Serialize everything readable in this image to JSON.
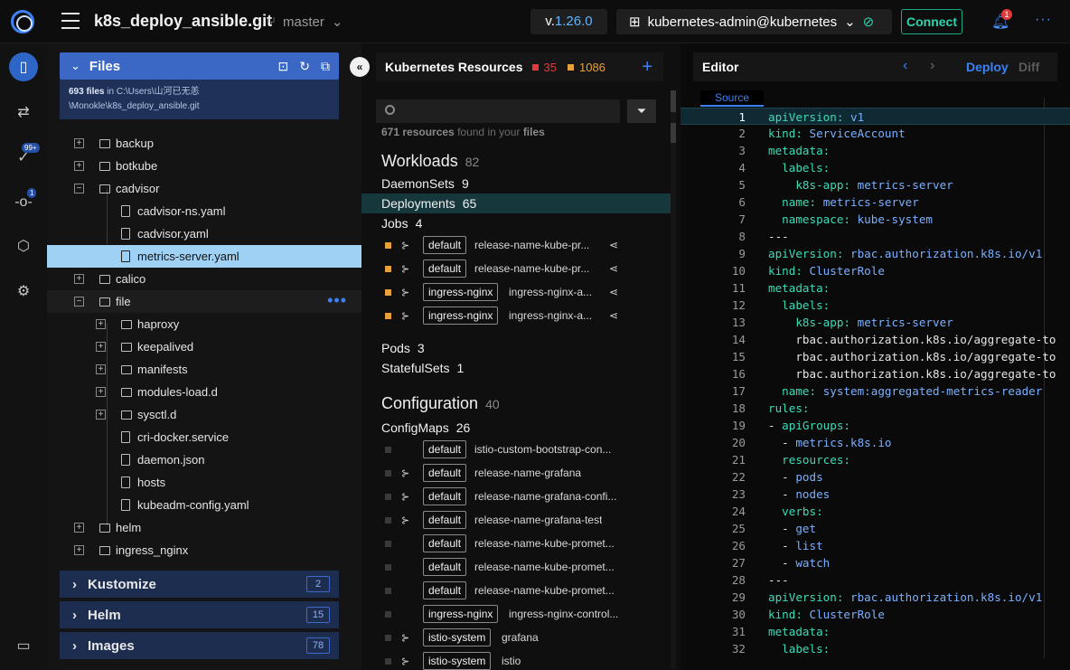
{
  "topbar": {
    "repo": "k8s_deploy_ansible.git",
    "branch": "master",
    "version_prefix": "v.",
    "version_num": "1.26.0",
    "cluster": "kubernetes-admin@kubernetes",
    "connect": "Connect",
    "notifications": "1",
    "more": "···"
  },
  "rail": {
    "badge_validation": "99+",
    "badge_git": "1"
  },
  "files": {
    "title": "Files",
    "count": "693 files",
    "in": "in",
    "path1": "C:\\Users\\山河已无恙",
    "path2": "\\Monokle\\k8s_deploy_ansible.git",
    "tree": [
      {
        "label": "backup"
      },
      {
        "label": "botkube"
      },
      {
        "label": "cadvisor"
      },
      {
        "label": "cadvisor-ns.yaml"
      },
      {
        "label": "cadvisor.yaml"
      },
      {
        "label": "metrics-server.yaml"
      },
      {
        "label": "calico"
      },
      {
        "label": "file"
      },
      {
        "label": "haproxy"
      },
      {
        "label": "keepalived"
      },
      {
        "label": "manifests"
      },
      {
        "label": "modules-load.d"
      },
      {
        "label": "sysctl.d"
      },
      {
        "label": "cri-docker.service"
      },
      {
        "label": "daemon.json"
      },
      {
        "label": "hosts"
      },
      {
        "label": "kubeadm-config.yaml"
      },
      {
        "label": "helm"
      },
      {
        "label": "ingress_nginx"
      }
    ],
    "sections": [
      {
        "label": "Kustomize",
        "count": "2"
      },
      {
        "label": "Helm",
        "count": "15"
      },
      {
        "label": "Images",
        "count": "78"
      }
    ]
  },
  "resources": {
    "title": "Kubernetes Resources",
    "errors": "35",
    "warnings": "1086",
    "search_placeholder": "",
    "found_count": "671 resources",
    "found_mid": "found in your",
    "found_end": "files",
    "workloads": {
      "label": "Workloads",
      "count": "82"
    },
    "daemonsets": {
      "label": "DaemonSets",
      "count": "9"
    },
    "deployments": {
      "label": "Deployments",
      "count": "65"
    },
    "jobs": {
      "label": "Jobs",
      "count": "4"
    },
    "job_rows": [
      {
        "ns": "default",
        "name": "release-name-kube-pr..."
      },
      {
        "ns": "default",
        "name": "release-name-kube-pr..."
      },
      {
        "ns": "ingress-nginx",
        "name": "ingress-nginx-a..."
      },
      {
        "ns": "ingress-nginx",
        "name": "ingress-nginx-a..."
      }
    ],
    "pods": {
      "label": "Pods",
      "count": "3"
    },
    "statefulsets": {
      "label": "StatefulSets",
      "count": "1"
    },
    "configuration": {
      "label": "Configuration",
      "count": "40"
    },
    "configmaps": {
      "label": "ConfigMaps",
      "count": "26"
    },
    "cm_rows": [
      {
        "ns": "default",
        "name": "istio-custom-bootstrap-con..."
      },
      {
        "ns": "default",
        "name": "release-name-grafana"
      },
      {
        "ns": "default",
        "name": "release-name-grafana-confi..."
      },
      {
        "ns": "default",
        "name": "release-name-grafana-test"
      },
      {
        "ns": "default",
        "name": "release-name-kube-promet..."
      },
      {
        "ns": "default",
        "name": "release-name-kube-promet..."
      },
      {
        "ns": "default",
        "name": "release-name-kube-promet..."
      },
      {
        "ns": "ingress-nginx",
        "name": "ingress-nginx-control..."
      },
      {
        "ns": "istio-system",
        "name": "grafana"
      },
      {
        "ns": "istio-system",
        "name": "istio"
      }
    ]
  },
  "editor": {
    "title": "Editor",
    "deploy": "Deploy",
    "diff": "Diff",
    "tab": "Source",
    "lines": [
      "apiVersion: v1",
      "kind: ServiceAccount",
      "metadata:",
      "  labels:",
      "    k8s-app: metrics-server",
      "  name: metrics-server",
      "  namespace: kube-system",
      "---",
      "apiVersion: rbac.authorization.k8s.io/v1",
      "kind: ClusterRole",
      "metadata:",
      "  labels:",
      "    k8s-app: metrics-server",
      "    rbac.authorization.k8s.io/aggregate-to",
      "    rbac.authorization.k8s.io/aggregate-to",
      "    rbac.authorization.k8s.io/aggregate-to",
      "  name: system:aggregated-metrics-reader",
      "rules:",
      "- apiGroups:",
      "  - metrics.k8s.io",
      "  resources:",
      "  - pods",
      "  - nodes",
      "  verbs:",
      "  - get",
      "  - list",
      "  - watch",
      "---",
      "apiVersion: rbac.authorization.k8s.io/v1",
      "kind: ClusterRole",
      "metadata:",
      "  labels:"
    ]
  },
  "colors": {
    "accent": "#3b82f6",
    "yaml_key": "#3ddbb8",
    "yaml_value": "#7ab0ff",
    "error": "#e23a3a",
    "warning": "#e8a13a"
  }
}
